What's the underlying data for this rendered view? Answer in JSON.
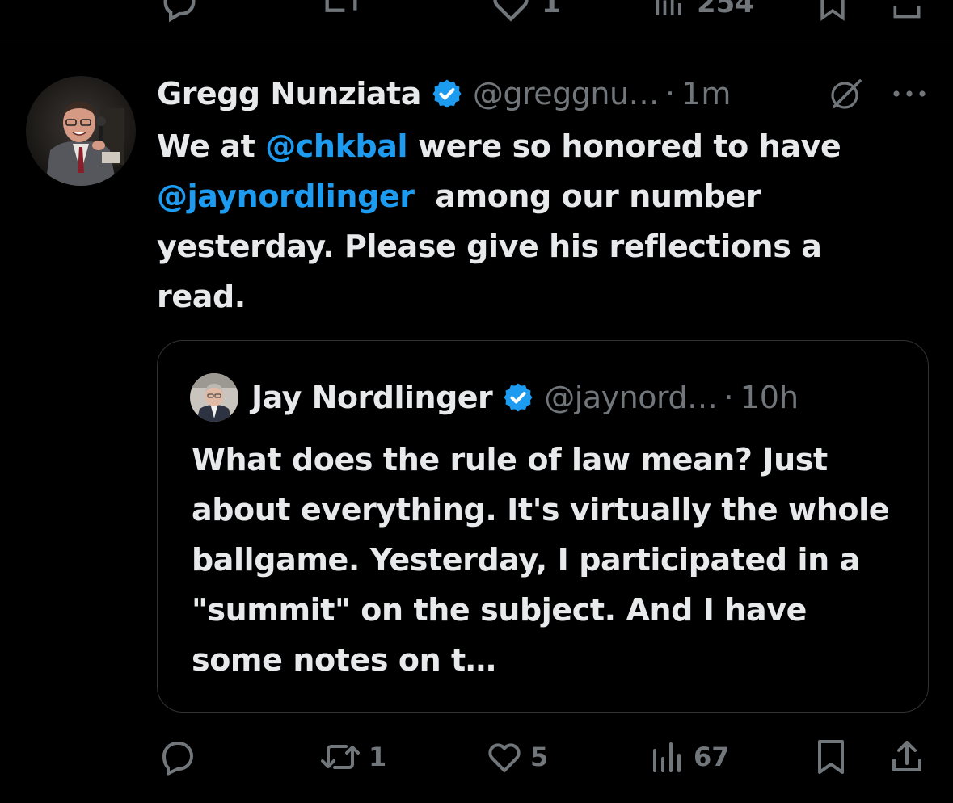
{
  "previous_tweet_actions": {
    "like_count": "1",
    "views_count": "254"
  },
  "tweet": {
    "display_name": "Gregg Nunziata",
    "handle": "@greggnu…",
    "separator": "·",
    "time": "1m",
    "text": {
      "part1": "We at ",
      "mention1": "@chkbal",
      "part2": " were so honored to have ",
      "mention2": "@jaynordlinger",
      "part3": "  among our number yesterday. Please give his reflections a read."
    }
  },
  "quote": {
    "display_name": "Jay Nordlinger",
    "handle": "@jaynord…",
    "separator": "·",
    "time": "10h",
    "text": "What does the rule of law mean? Just about everything. It's virtually the whole ballgame. Yesterday, I participated in a \"summit\" on the subject. And I have some notes on t…"
  },
  "actions": {
    "reply_count": "",
    "repost_count": "1",
    "like_count": "5",
    "views_count": "67"
  },
  "colors": {
    "background": "#000000",
    "text": "#e7e9ea",
    "secondary": "#71767b",
    "accent": "#1d9bf0",
    "border": "#2f3336"
  },
  "icons": [
    "verified-badge-icon",
    "grok-icon",
    "more-icon",
    "reply-icon",
    "repost-icon",
    "like-icon",
    "views-icon",
    "bookmark-icon",
    "share-icon"
  ]
}
